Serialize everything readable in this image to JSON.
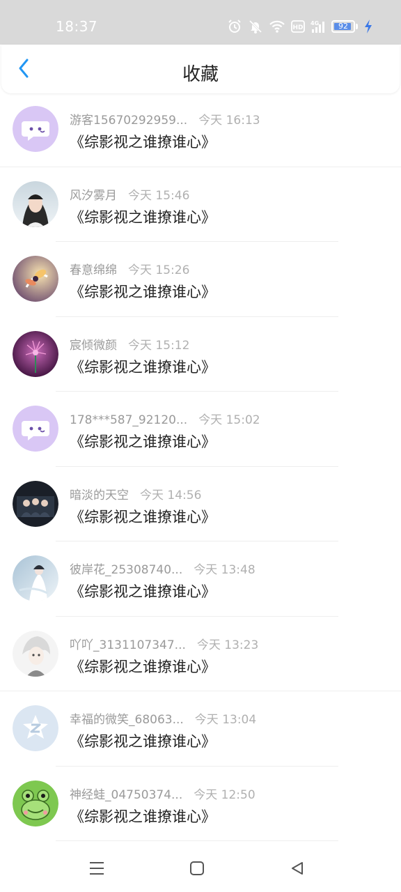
{
  "status_bar": {
    "time": "18:37",
    "battery_level": "92",
    "battery_fraction": 0.92,
    "icons": [
      "alarm-icon",
      "mute-icon",
      "wifi-icon",
      "hd-icon",
      "4g-signal-icon",
      "battery-icon",
      "charging-icon"
    ]
  },
  "header": {
    "title": "收藏",
    "back_icon": "chevron-left-icon",
    "accent_color": "#2196f3"
  },
  "favorites": [
    {
      "username": "游客15670292959...",
      "time": "今天 16:13",
      "title": "《综影视之谁撩谁心》",
      "avatar": "chat-bubble-avatar"
    },
    {
      "username": "风汐雾月",
      "time": "今天 15:46",
      "title": "《综影视之谁撩谁心》",
      "avatar": "portrait-avatar"
    },
    {
      "username": "春意绵绵",
      "time": "今天 15:26",
      "title": "《综影视之谁撩谁心》",
      "avatar": "flower-avatar"
    },
    {
      "username": "宸倾微颜",
      "time": "今天 15:12",
      "title": "《综影视之谁撩谁心》",
      "avatar": "purple-flower-avatar"
    },
    {
      "username": "178***587_92120...",
      "time": "今天 15:02",
      "title": "《综影视之谁撩谁心》",
      "avatar": "chat-bubble-avatar"
    },
    {
      "username": "暗淡的天空",
      "time": "今天 14:56",
      "title": "《综影视之谁撩谁心》",
      "avatar": "group-photo-avatar"
    },
    {
      "username": "彼岸花_25308740...",
      "time": "今天 13:48",
      "title": "《综影视之谁撩谁心》",
      "avatar": "snow-figure-avatar"
    },
    {
      "username": "吖吖_3131107347...",
      "time": "今天 13:23",
      "title": "《综影视之谁撩谁心》",
      "avatar": "anime-avatar"
    },
    {
      "username": "幸福的微笑_68063...",
      "time": "今天 13:04",
      "title": "《综影视之谁撩谁心》",
      "avatar": "qzone-star-avatar"
    },
    {
      "username": "神经蛙_04750374...",
      "time": "今天 12:50",
      "title": "《综影视之谁撩谁心》",
      "avatar": "frog-avatar"
    }
  ],
  "nav_bar": {
    "icons": [
      "menu-icon",
      "home-square-icon",
      "back-triangle-icon"
    ]
  }
}
